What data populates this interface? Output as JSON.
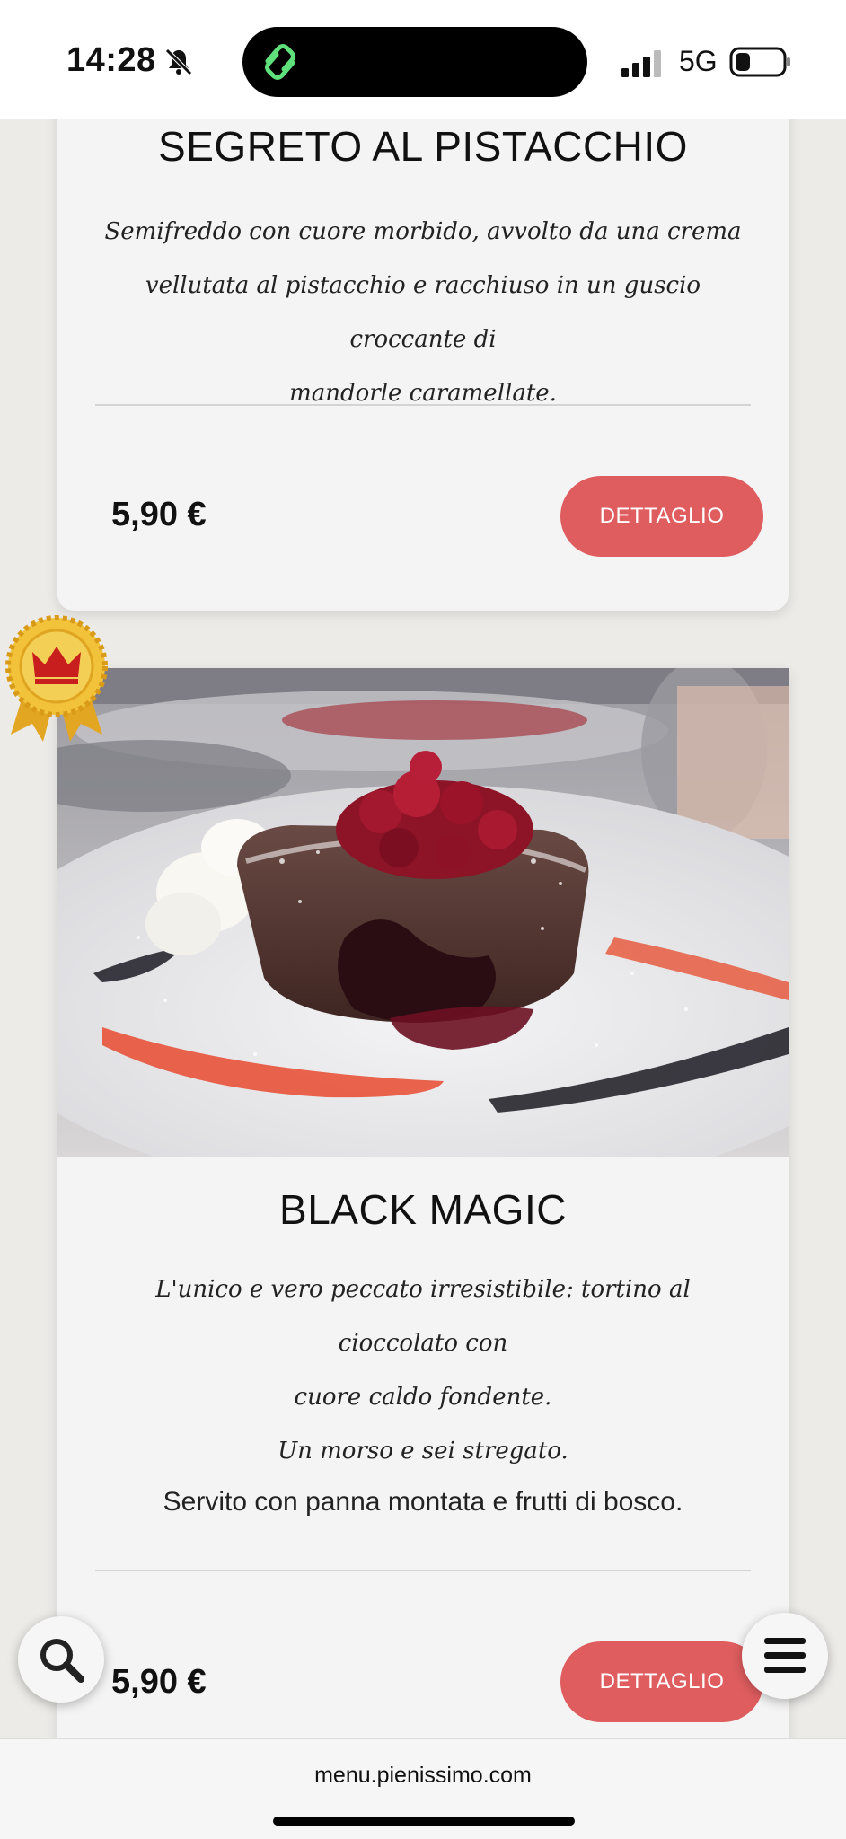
{
  "status_bar": {
    "time": "14:28",
    "network": "5G"
  },
  "cards": [
    {
      "title": "SEGRETO AL PISTACCHIO",
      "description_lines": [
        "Semifreddo con cuore morbido, avvolto da una crema",
        "vellutata al pistacchio e racchiuso in un guscio croccante di",
        "mandorle caramellate."
      ],
      "price": "5,90 €",
      "button_label": "DETTAGLIO"
    },
    {
      "title": "BLACK MAGIC",
      "description_lines": [
        "L'unico e vero peccato irresistibile: tortino al cioccolato con",
        "cuore caldo fondente.",
        "Un morso e sei stregato."
      ],
      "note": "Servito con panna montata e frutti di bosco.",
      "price": "5,90 €",
      "button_label": "DETTAGLIO",
      "badge": "crown-award-icon"
    }
  ],
  "url_bar": {
    "url": "menu.pienissimo.com"
  },
  "colors": {
    "accent_button": "#df5d5f",
    "card_bg": "#f4f4f4",
    "page_bg": "#ecebe8"
  },
  "icons": {
    "search": "search-icon",
    "menu": "hamburger-menu-icon"
  }
}
